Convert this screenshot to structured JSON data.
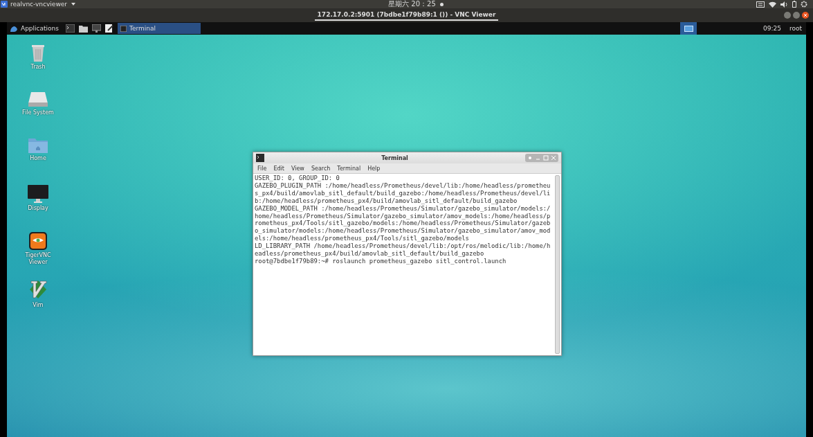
{
  "top_bar": {
    "app_menu": "realvnc-vncviewer",
    "clock": "星期六 20：25"
  },
  "vnc_window": {
    "title": "172.17.0.2:5901 (7bdbe1f79b89:1 ()) - VNC Viewer"
  },
  "panel": {
    "applications": "Applications",
    "launchers": [
      {
        "kind": "terminal"
      },
      {
        "kind": "files"
      },
      {
        "kind": "monitor"
      },
      {
        "kind": "editor"
      }
    ],
    "tasks": [
      {
        "label": "Terminal",
        "selected": true
      }
    ],
    "clock": "09:25",
    "user": "root"
  },
  "desktop_icons": [
    {
      "kind": "trash",
      "label": "Trash"
    },
    {
      "kind": "drive",
      "label": "File System"
    },
    {
      "kind": "folder",
      "label": "Home"
    },
    {
      "kind": "monitor",
      "label": "Display"
    },
    {
      "kind": "tiger",
      "label": "TigerVNC Viewer"
    },
    {
      "kind": "vim",
      "label": "Vim"
    }
  ],
  "terminal": {
    "title": "Terminal",
    "menu": [
      "File",
      "Edit",
      "View",
      "Search",
      "Terminal",
      "Help"
    ],
    "lines": [
      "USER_ID: 0, GROUP_ID: 0",
      "GAZEBO_PLUGIN_PATH :/home/headless/Prometheus/devel/lib:/home/headless/prometheu",
      "s_px4/build/amovlab_sitl_default/build_gazebo:/home/headless/Prometheus/devel/li",
      "b:/home/headless/prometheus_px4/build/amovlab_sitl_default/build_gazebo",
      "GAZEBO_MODEL_PATH :/home/headless/Prometheus/Simulator/gazebo_simulator/models:/",
      "home/headless/Prometheus/Simulator/gazebo_simulator/amov_models:/home/headless/p",
      "rometheus_px4/Tools/sitl_gazebo/models:/home/headless/Prometheus/Simulator/gazeb",
      "o_simulator/models:/home/headless/Prometheus/Simulator/gazebo_simulator/amov_mod",
      "els:/home/headless/prometheus_px4/Tools/sitl_gazebo/models",
      "LD_LIBRARY_PATH /home/headless/Prometheus/devel/lib:/opt/ros/melodic/lib:/home/h",
      "eadless/prometheus_px4/build/amovlab_sitl_default/build_gazebo",
      "root@7bdbe1f79b89:~# roslaunch prometheus_gazebo sitl_control.launch"
    ]
  }
}
